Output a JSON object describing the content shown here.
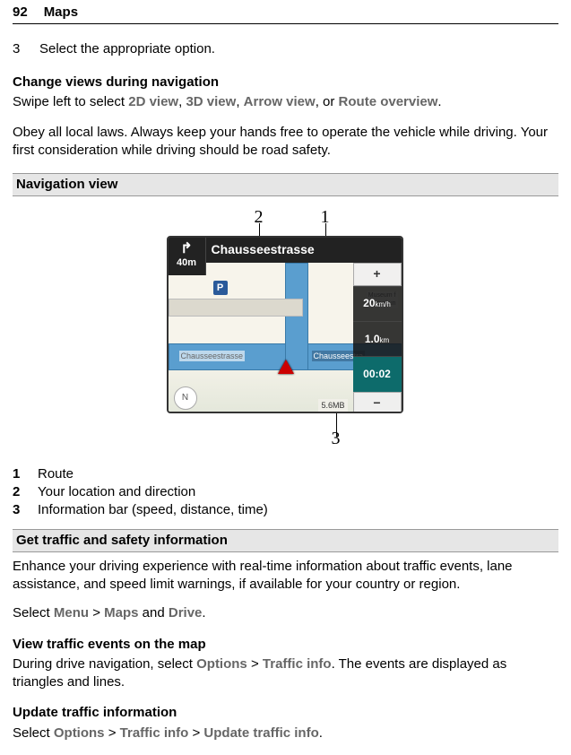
{
  "header": {
    "page_number": "92",
    "title": "Maps"
  },
  "step3": {
    "number": "3",
    "text": "Select the appropriate option."
  },
  "change_views": {
    "heading": "Change views during navigation",
    "pre": "Swipe left to select ",
    "v1": "2D view",
    "sep1": ", ",
    "v2": "3D view",
    "sep2": ", ",
    "v3": "Arrow view",
    "sep3": ", or ",
    "v4": "Route overview",
    "post": "."
  },
  "safety_note": "Obey all local laws. Always keep your hands free to operate the vehicle while driving. Your first consideration while driving should be road safety.",
  "nav_view_heading": "Navigation view",
  "callouts": {
    "c1": "1",
    "c2": "2",
    "c3": "3"
  },
  "nav_shot": {
    "street_top": "Chausseestrasse",
    "turn_distance": "40m",
    "road_label1": "Chausseestrasse",
    "road_label2": "Chausseestra",
    "parking": "P",
    "poi_label": "Museum f\nNaturkun",
    "speed_val": "20",
    "speed_unit": "km/h",
    "dist_val": "1.0",
    "dist_unit": "km",
    "time_val": "00:02",
    "zoom_in": "+",
    "zoom_out": "−",
    "data_size": "5.6MB",
    "compass_dir": "N"
  },
  "legend": {
    "n1": "1",
    "t1": "Route",
    "n2": "2",
    "t2": "Your location and direction",
    "n3": "3",
    "t3": "Information bar (speed, distance, time)"
  },
  "traffic_heading": "Get traffic and safety information",
  "traffic_intro": "Enhance your driving experience with real-time information about traffic events, lane assistance, and speed limit warnings, if available for your country or region.",
  "select_line": {
    "pre": "Select ",
    "menu": "Menu",
    "gt1": " > ",
    "maps": "Maps",
    "and": " and ",
    "drive": "Drive",
    "post": "."
  },
  "view_events": {
    "heading": "View traffic events on the map",
    "pre": "During drive navigation, select ",
    "options": "Options",
    "gt": " > ",
    "traffic_info": "Traffic info",
    "post": ". The events are displayed as triangles and lines."
  },
  "update_traffic": {
    "heading": "Update traffic information",
    "pre": "Select ",
    "options": "Options",
    "gt1": " > ",
    "ti": "Traffic info",
    "gt2": " > ",
    "uti": "Update traffic info",
    "post": "."
  }
}
